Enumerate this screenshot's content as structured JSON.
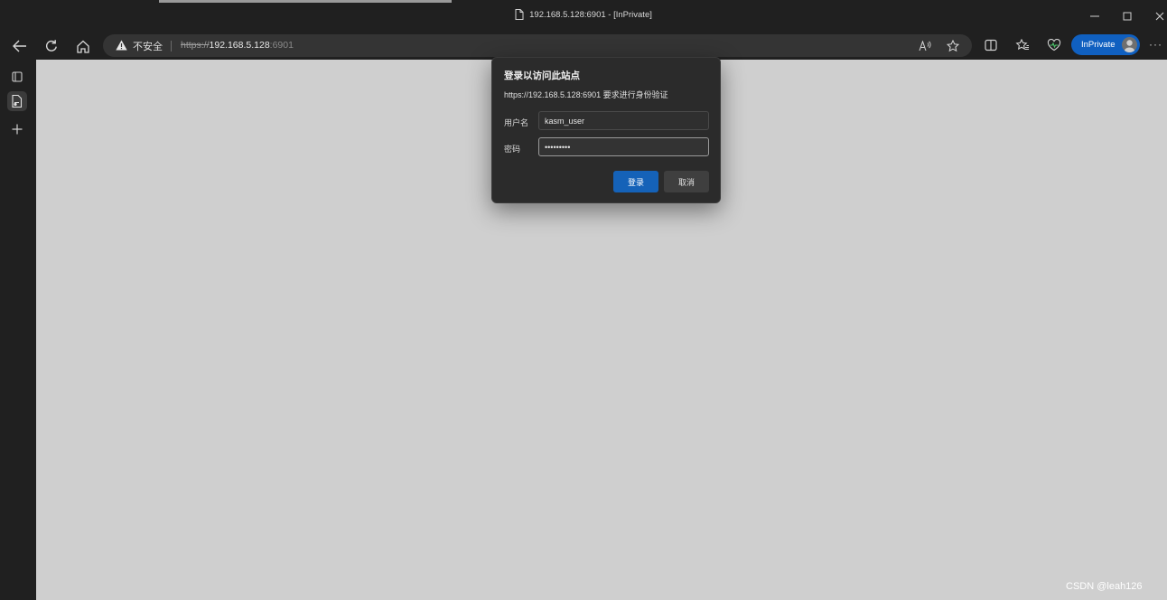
{
  "window": {
    "title": "192.168.5.128:6901 - [InPrivate]",
    "controls": [
      "minimize",
      "maximize",
      "close"
    ]
  },
  "navbar": {
    "security_label": "不安全",
    "url_scheme": "https://",
    "url_host": "192.168.5.128",
    "url_port": ":6901",
    "inprivate_label": "InPrivate",
    "more_label": "···"
  },
  "dialog": {
    "title": "登录以访问此站点",
    "message": "https://192.168.5.128:6901 要求进行身份验证",
    "username_label": "用户名",
    "username_value": "kasm_user",
    "password_label": "密码",
    "password_value": "•••••••••",
    "login_label": "登录",
    "cancel_label": "取消"
  },
  "watermark": "CSDN @leah126",
  "colors": {
    "accent": "#1562b8",
    "inprivate": "#1060c0",
    "page_background": "#cfcfcf",
    "chrome": "#202020"
  }
}
